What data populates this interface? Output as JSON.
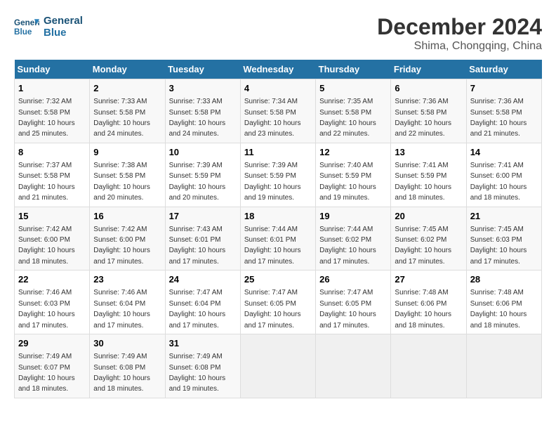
{
  "header": {
    "logo_line1": "General",
    "logo_line2": "Blue",
    "month": "December 2024",
    "location": "Shima, Chongqing, China"
  },
  "weekdays": [
    "Sunday",
    "Monday",
    "Tuesday",
    "Wednesday",
    "Thursday",
    "Friday",
    "Saturday"
  ],
  "weeks": [
    [
      {
        "day": "1",
        "sunrise": "7:32 AM",
        "sunset": "5:58 PM",
        "daylight": "10 hours and 25 minutes."
      },
      {
        "day": "2",
        "sunrise": "7:33 AM",
        "sunset": "5:58 PM",
        "daylight": "10 hours and 24 minutes."
      },
      {
        "day": "3",
        "sunrise": "7:33 AM",
        "sunset": "5:58 PM",
        "daylight": "10 hours and 24 minutes."
      },
      {
        "day": "4",
        "sunrise": "7:34 AM",
        "sunset": "5:58 PM",
        "daylight": "10 hours and 23 minutes."
      },
      {
        "day": "5",
        "sunrise": "7:35 AM",
        "sunset": "5:58 PM",
        "daylight": "10 hours and 22 minutes."
      },
      {
        "day": "6",
        "sunrise": "7:36 AM",
        "sunset": "5:58 PM",
        "daylight": "10 hours and 22 minutes."
      },
      {
        "day": "7",
        "sunrise": "7:36 AM",
        "sunset": "5:58 PM",
        "daylight": "10 hours and 21 minutes."
      }
    ],
    [
      {
        "day": "8",
        "sunrise": "7:37 AM",
        "sunset": "5:58 PM",
        "daylight": "10 hours and 21 minutes."
      },
      {
        "day": "9",
        "sunrise": "7:38 AM",
        "sunset": "5:58 PM",
        "daylight": "10 hours and 20 minutes."
      },
      {
        "day": "10",
        "sunrise": "7:39 AM",
        "sunset": "5:59 PM",
        "daylight": "10 hours and 20 minutes."
      },
      {
        "day": "11",
        "sunrise": "7:39 AM",
        "sunset": "5:59 PM",
        "daylight": "10 hours and 19 minutes."
      },
      {
        "day": "12",
        "sunrise": "7:40 AM",
        "sunset": "5:59 PM",
        "daylight": "10 hours and 19 minutes."
      },
      {
        "day": "13",
        "sunrise": "7:41 AM",
        "sunset": "5:59 PM",
        "daylight": "10 hours and 18 minutes."
      },
      {
        "day": "14",
        "sunrise": "7:41 AM",
        "sunset": "6:00 PM",
        "daylight": "10 hours and 18 minutes."
      }
    ],
    [
      {
        "day": "15",
        "sunrise": "7:42 AM",
        "sunset": "6:00 PM",
        "daylight": "10 hours and 18 minutes."
      },
      {
        "day": "16",
        "sunrise": "7:42 AM",
        "sunset": "6:00 PM",
        "daylight": "10 hours and 17 minutes."
      },
      {
        "day": "17",
        "sunrise": "7:43 AM",
        "sunset": "6:01 PM",
        "daylight": "10 hours and 17 minutes."
      },
      {
        "day": "18",
        "sunrise": "7:44 AM",
        "sunset": "6:01 PM",
        "daylight": "10 hours and 17 minutes."
      },
      {
        "day": "19",
        "sunrise": "7:44 AM",
        "sunset": "6:02 PM",
        "daylight": "10 hours and 17 minutes."
      },
      {
        "day": "20",
        "sunrise": "7:45 AM",
        "sunset": "6:02 PM",
        "daylight": "10 hours and 17 minutes."
      },
      {
        "day": "21",
        "sunrise": "7:45 AM",
        "sunset": "6:03 PM",
        "daylight": "10 hours and 17 minutes."
      }
    ],
    [
      {
        "day": "22",
        "sunrise": "7:46 AM",
        "sunset": "6:03 PM",
        "daylight": "10 hours and 17 minutes."
      },
      {
        "day": "23",
        "sunrise": "7:46 AM",
        "sunset": "6:04 PM",
        "daylight": "10 hours and 17 minutes."
      },
      {
        "day": "24",
        "sunrise": "7:47 AM",
        "sunset": "6:04 PM",
        "daylight": "10 hours and 17 minutes."
      },
      {
        "day": "25",
        "sunrise": "7:47 AM",
        "sunset": "6:05 PM",
        "daylight": "10 hours and 17 minutes."
      },
      {
        "day": "26",
        "sunrise": "7:47 AM",
        "sunset": "6:05 PM",
        "daylight": "10 hours and 17 minutes."
      },
      {
        "day": "27",
        "sunrise": "7:48 AM",
        "sunset": "6:06 PM",
        "daylight": "10 hours and 18 minutes."
      },
      {
        "day": "28",
        "sunrise": "7:48 AM",
        "sunset": "6:06 PM",
        "daylight": "10 hours and 18 minutes."
      }
    ],
    [
      {
        "day": "29",
        "sunrise": "7:49 AM",
        "sunset": "6:07 PM",
        "daylight": "10 hours and 18 minutes."
      },
      {
        "day": "30",
        "sunrise": "7:49 AM",
        "sunset": "6:08 PM",
        "daylight": "10 hours and 18 minutes."
      },
      {
        "day": "31",
        "sunrise": "7:49 AM",
        "sunset": "6:08 PM",
        "daylight": "10 hours and 19 minutes."
      },
      null,
      null,
      null,
      null
    ]
  ]
}
